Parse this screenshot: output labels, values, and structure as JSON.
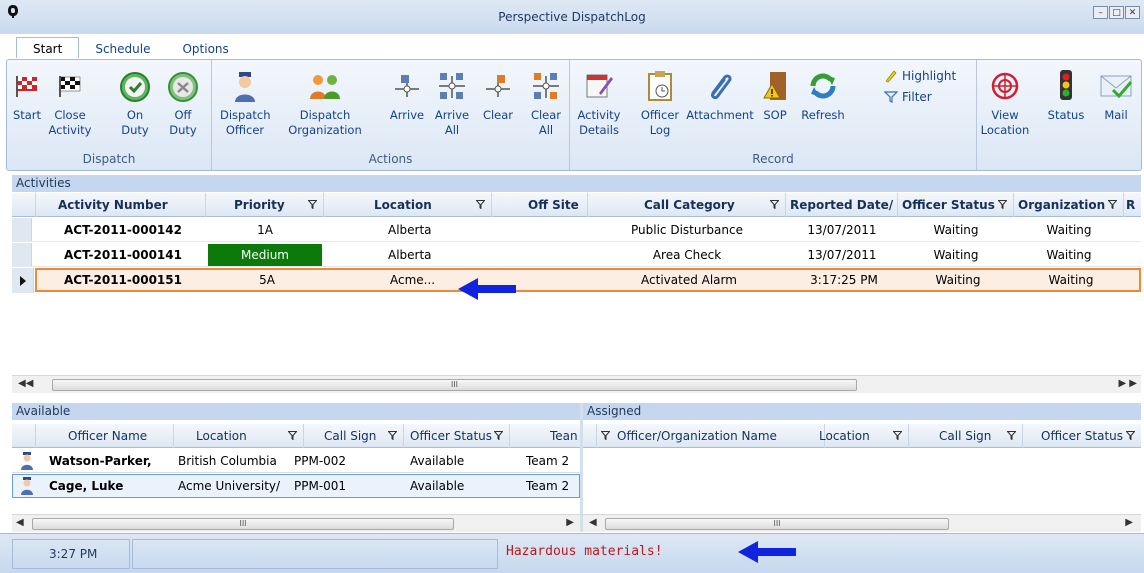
{
  "window": {
    "title": "Perspective DispatchLog"
  },
  "tabs": [
    "Start",
    "Schedule",
    "Options"
  ],
  "ribbon": {
    "groups": {
      "dispatch": "Dispatch",
      "actions": "Actions",
      "record": "Record"
    },
    "buttons": {
      "start": "Start",
      "close_activity": "Close\nActivity",
      "on_duty": "On\nDuty",
      "off_duty": "Off\nDuty",
      "dispatch_officer": "Dispatch\nOfficer",
      "dispatch_organization": "Dispatch\nOrganization",
      "arrive": "Arrive",
      "arrive_all": "Arrive\nAll",
      "clear": "Clear",
      "clear_all": "Clear\nAll",
      "activity_details": "Activity\nDetails",
      "officer_log": "Officer\nLog",
      "attachment": "Attachment",
      "sop": "SOP",
      "refresh": "Refresh",
      "highlight": "Highlight",
      "filter": "Filter",
      "view_location": "View\nLocation",
      "status": "Status",
      "mail": "Mail"
    }
  },
  "activities": {
    "section_title": "Activities",
    "columns": [
      "Activity Number",
      "Priority",
      "Location",
      "Off Site",
      "Call Category",
      "Reported Date/",
      "Officer Status",
      "Organization",
      "R"
    ],
    "rows": [
      {
        "number": "ACT-2011-000142",
        "priority": "1A",
        "location": "Alberta",
        "off_site": "",
        "category": "Public Disturbance",
        "reported": "13/07/2011",
        "officer_status": "Waiting",
        "organization": "Waiting"
      },
      {
        "number": "ACT-2011-000141",
        "priority": "Medium",
        "location": "Alberta",
        "off_site": "",
        "category": "Area Check",
        "reported": "13/07/2011",
        "officer_status": "Waiting",
        "organization": "Waiting"
      },
      {
        "number": "ACT-2011-000151",
        "priority": "5A",
        "location": "Acme...",
        "off_site": "",
        "category": "Activated Alarm",
        "reported": "3:17:25 PM",
        "officer_status": "Waiting",
        "organization": "Waiting"
      }
    ]
  },
  "available": {
    "section_title": "Available",
    "columns": [
      "Officer Name",
      "Location",
      "Call Sign",
      "Officer Status",
      "Tean"
    ],
    "rows": [
      {
        "name": "Watson-Parker,",
        "location": "British Columbia",
        "call_sign": "PPM-002",
        "status": "Available",
        "team": "Team 2"
      },
      {
        "name": "Cage, Luke",
        "location": "Acme University/",
        "call_sign": "PPM-001",
        "status": "Available",
        "team": "Team 2"
      }
    ]
  },
  "assigned": {
    "section_title": "Assigned",
    "columns": [
      "Officer/Organization Name",
      "Location",
      "Call Sign",
      "Officer Status"
    ]
  },
  "scroll": {
    "thumb_glyph": "III"
  },
  "statusbar": {
    "time": "3:27 PM",
    "message": "Hazardous materials!"
  },
  "colors": {
    "priority_medium_bg": "#0b7a0b",
    "selected_row_bg": "#fdeee3",
    "selected_row_border": "#f0883a",
    "message_color": "#c0181b",
    "arrow": "#1024e0"
  }
}
